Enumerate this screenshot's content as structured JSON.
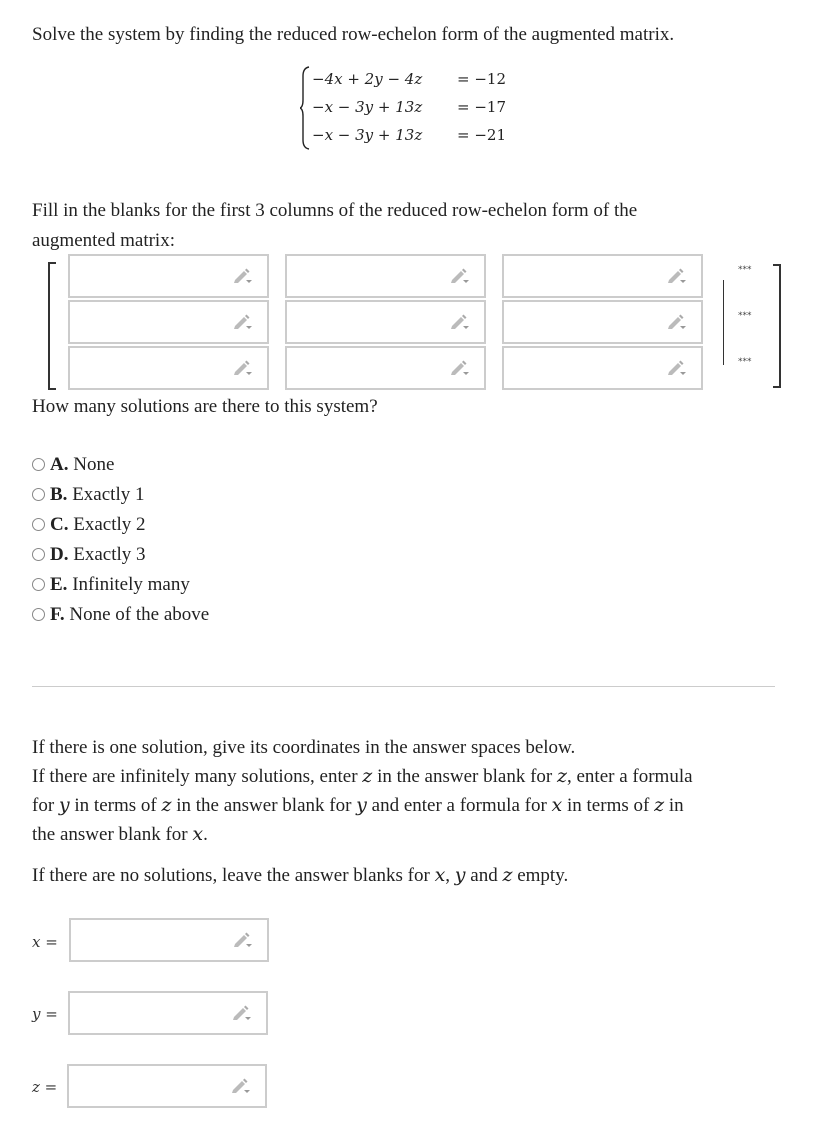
{
  "question": {
    "instruction": "Solve the system by finding the reduced row-echelon form of the augmented matrix.",
    "system": [
      {
        "lhs": "−4x + 2y − 4z",
        "rhs": "= −12"
      },
      {
        "lhs": "−x − 3y + 13z",
        "rhs": "= −17"
      },
      {
        "lhs": "−x − 3y + 13z",
        "rhs": "= −21"
      }
    ]
  },
  "matrix_section": {
    "prompt_line1": "Fill in the blanks for the first 3 columns of the reduced row-echelon form of the",
    "prompt_line2": "augmented matrix:",
    "rows": [
      {
        "cells": [
          "",
          "",
          ""
        ],
        "augmented": "***"
      },
      {
        "cells": [
          "",
          "",
          ""
        ],
        "augmented": "***"
      },
      {
        "cells": [
          "",
          "",
          ""
        ],
        "augmented": "***"
      }
    ]
  },
  "solutions_question": {
    "prompt": "How many solutions are there to this system?",
    "options": [
      {
        "letter": "A.",
        "label": "None",
        "selected": false
      },
      {
        "letter": "B.",
        "label": "Exactly 1",
        "selected": false
      },
      {
        "letter": "C.",
        "label": "Exactly 2",
        "selected": false
      },
      {
        "letter": "D.",
        "label": "Exactly 3",
        "selected": false
      },
      {
        "letter": "E.",
        "label": "Infinitely many",
        "selected": false
      },
      {
        "letter": "F.",
        "label": "None of the above",
        "selected": false
      }
    ]
  },
  "coordinates_section": {
    "line1": "If there is one solution, give its coordinates in the answer spaces below.",
    "line2a": "If there are infinitely many solutions, enter ",
    "line2b": " in the answer blank for ",
    "line2c": ", enter a formula",
    "line3a": "for ",
    "line3b": " in terms of ",
    "line3c": " in the answer blank for ",
    "line3d": " and enter a formula for ",
    "line3e": " in terms of ",
    "line3f": " in",
    "line4a": "the answer blank for ",
    "line4b": ".",
    "line5a": "If there are no solutions, leave the answer blanks for ",
    "line5b": ", ",
    "line5c": " and ",
    "line5d": " empty.",
    "var_x": "x",
    "var_y": "y",
    "var_z": "z",
    "fields": [
      {
        "label": "x =",
        "value": ""
      },
      {
        "label": "y =",
        "value": ""
      },
      {
        "label": "z =",
        "value": ""
      }
    ]
  },
  "icons": {
    "input_tool": "pencil-dropdown-icon"
  }
}
